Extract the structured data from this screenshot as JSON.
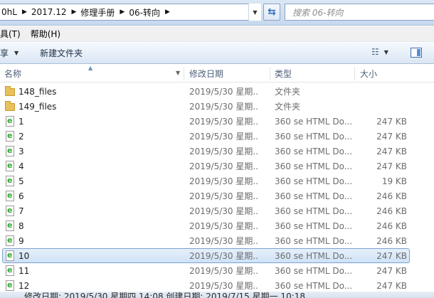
{
  "address": {
    "crumbs": [
      "0hL",
      "2017.12",
      "修理手册",
      "06-转向"
    ],
    "search_placeholder": "搜索 06-转向"
  },
  "menu": [
    "具(T)",
    "帮助(H)"
  ],
  "toolbar": {
    "share_label": "享",
    "new_folder_label": "新建文件夹"
  },
  "columns": {
    "name": "名称",
    "date": "修改日期",
    "type": "类型",
    "size": "大小"
  },
  "files": [
    {
      "name": "148_files",
      "date": "2019/5/30 星期...",
      "type": "文件夹",
      "size": "",
      "kind": "folder",
      "selected": false
    },
    {
      "name": "149_files",
      "date": "2019/5/30 星期...",
      "type": "文件夹",
      "size": "",
      "kind": "folder",
      "selected": false
    },
    {
      "name": "1",
      "date": "2019/5/30 星期...",
      "type": "360 se HTML Do...",
      "size": "247 KB",
      "kind": "html",
      "selected": false
    },
    {
      "name": "2",
      "date": "2019/5/30 星期...",
      "type": "360 se HTML Do...",
      "size": "247 KB",
      "kind": "html",
      "selected": false
    },
    {
      "name": "3",
      "date": "2019/5/30 星期...",
      "type": "360 se HTML Do...",
      "size": "247 KB",
      "kind": "html",
      "selected": false
    },
    {
      "name": "4",
      "date": "2019/5/30 星期...",
      "type": "360 se HTML Do...",
      "size": "247 KB",
      "kind": "html",
      "selected": false
    },
    {
      "name": "5",
      "date": "2019/5/30 星期...",
      "type": "360 se HTML Do...",
      "size": "19 KB",
      "kind": "html",
      "selected": false
    },
    {
      "name": "6",
      "date": "2019/5/30 星期...",
      "type": "360 se HTML Do...",
      "size": "246 KB",
      "kind": "html",
      "selected": false
    },
    {
      "name": "7",
      "date": "2019/5/30 星期...",
      "type": "360 se HTML Do...",
      "size": "246 KB",
      "kind": "html",
      "selected": false
    },
    {
      "name": "8",
      "date": "2019/5/30 星期...",
      "type": "360 se HTML Do...",
      "size": "246 KB",
      "kind": "html",
      "selected": false
    },
    {
      "name": "9",
      "date": "2019/5/30 星期...",
      "type": "360 se HTML Do...",
      "size": "246 KB",
      "kind": "html",
      "selected": false
    },
    {
      "name": "10",
      "date": "2019/5/30 星期...",
      "type": "360 se HTML Do...",
      "size": "247 KB",
      "kind": "html",
      "selected": true
    },
    {
      "name": "11",
      "date": "2019/5/30 星期...",
      "type": "360 se HTML Do...",
      "size": "247 KB",
      "kind": "html",
      "selected": false
    },
    {
      "name": "12",
      "date": "2019/5/30 星期...",
      "type": "360 se HTML Do...",
      "size": "247 KB",
      "kind": "html",
      "selected": false
    }
  ],
  "status": {
    "text": "修改日期: 2019/5/30 星期四 14:08 创建日期: 2019/7/15 星期一 10:18"
  },
  "icons": {
    "folder": "folder-icon",
    "html": "html-document-icon",
    "refresh": "refresh-icon",
    "views": "views-icon",
    "preview_pane": "preview-pane-icon"
  }
}
